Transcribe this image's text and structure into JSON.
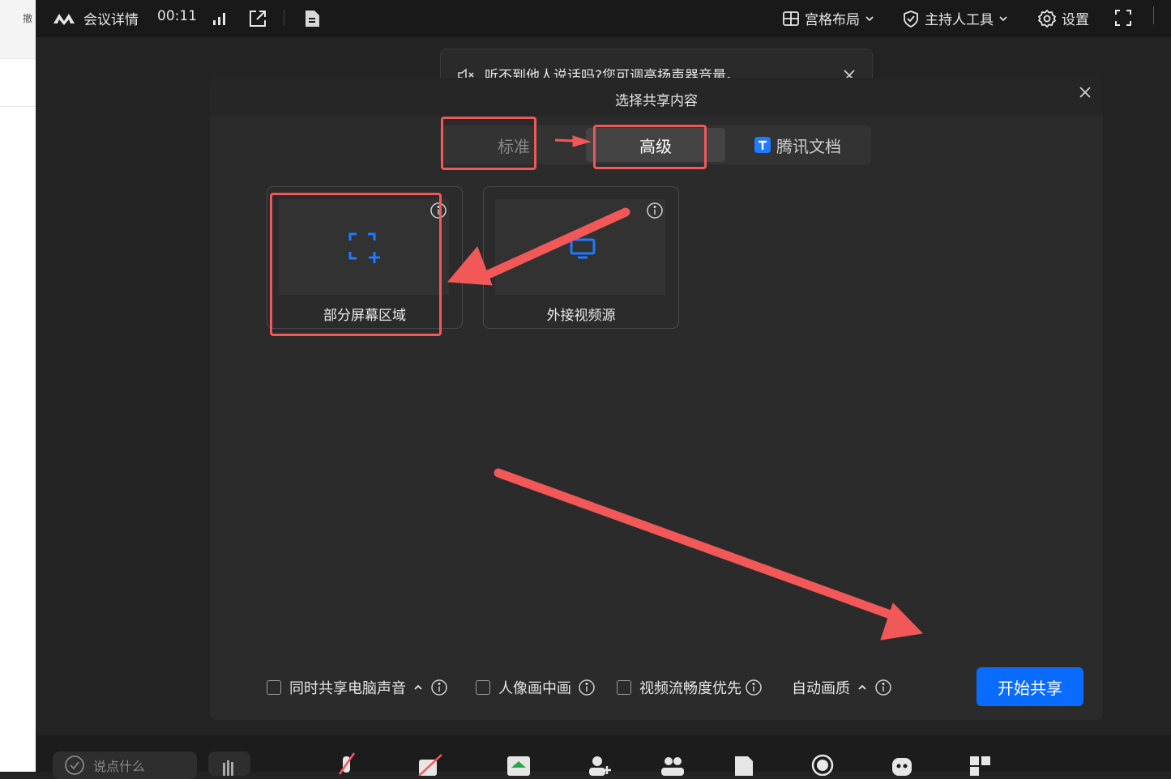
{
  "left_strip": {
    "undo_label": "撤"
  },
  "topbar": {
    "meeting_details": "会议详情",
    "timer": "00:11",
    "grid_layout": "宫格布局",
    "host_tools": "主持人工具",
    "settings": "设置"
  },
  "notice": {
    "text": "听不到他人说话吗?您可调高扬声器音量。"
  },
  "dialog": {
    "title": "选择共享内容",
    "tabs": {
      "standard": "标准",
      "advanced": "高级",
      "tencent_docs": "腾讯文档"
    },
    "cards": [
      {
        "label": "部分屏幕区域"
      },
      {
        "label": "外接视频源"
      }
    ],
    "options": {
      "share_audio": "同时共享电脑声音",
      "picture_in_picture": "人像画中画",
      "smooth_priority": "视频流畅度优先",
      "auto_quality": "自动画质"
    },
    "start_button": "开始共享"
  },
  "bottom": {
    "chat_placeholder": "说点什么"
  },
  "colors": {
    "accent": "#0a6cff",
    "annotation": "#f25858"
  }
}
